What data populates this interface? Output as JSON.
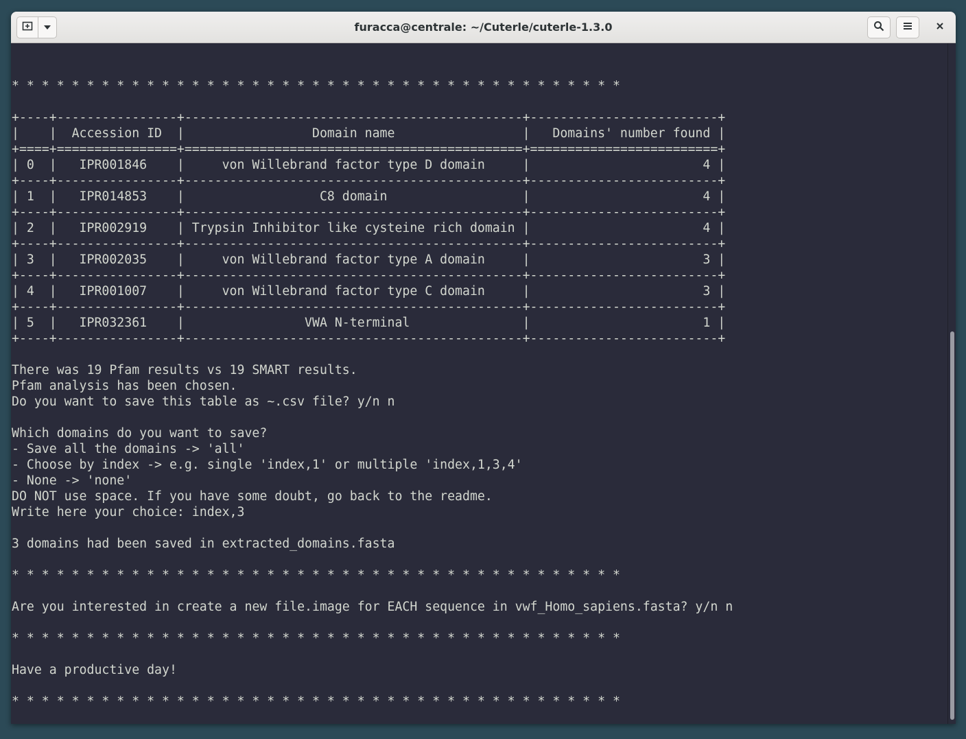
{
  "window": {
    "title": "furacca@centrale: ~/Cuterle/cuterle-1.3.0"
  },
  "icons": {
    "new_tab": "new-tab-icon",
    "dropdown": "chevron-down-icon",
    "search": "search-icon",
    "menu": "hamburger-menu-icon",
    "close": "close-icon"
  },
  "colors": {
    "terminal_bg": "#2a2b3a",
    "terminal_fg": "#d3d7cf",
    "prompt_user": "#8ae234",
    "prompt_path": "#729fcf",
    "desktop_bg": "#2c4a57"
  },
  "terminal": {
    "lines": [
      "",
      "* * * * * * * * * * * * * * * * * * * * * * * * * * * * * * * * * * * * * * * * *",
      "",
      "+----+----------------+---------------------------------------------+-------------------------+",
      "|    |  Accession ID  |                 Domain name                 |   Domains' number found |",
      "+====+================+=============================================+=========================+",
      "| 0  |   IPR001846    |     von Willebrand factor type D domain     |                       4 |",
      "+----+----------------+---------------------------------------------+-------------------------+",
      "| 1  |   IPR014853    |                  C8 domain                  |                       4 |",
      "+----+----------------+---------------------------------------------+-------------------------+",
      "| 2  |   IPR002919    | Trypsin Inhibitor like cysteine rich domain |                       4 |",
      "+----+----------------+---------------------------------------------+-------------------------+",
      "| 3  |   IPR002035    |     von Willebrand factor type A domain     |                       3 |",
      "+----+----------------+---------------------------------------------+-------------------------+",
      "| 4  |   IPR001007    |     von Willebrand factor type C domain     |                       3 |",
      "+----+----------------+---------------------------------------------+-------------------------+",
      "| 5  |   IPR032361    |                VWA N-terminal               |                       1 |",
      "+----+----------------+---------------------------------------------+-------------------------+",
      "",
      "There was 19 Pfam results vs 19 SMART results.",
      "Pfam analysis has been chosen.",
      "Do you want to save this table as ~.csv file? y/n n",
      "",
      "Which domains do you want to save?",
      "- Save all the domains -> 'all'",
      "- Choose by index -> e.g. single 'index,1' or multiple 'index,1,3,4'",
      "- None -> 'none'",
      "DO NOT use space. If you have some doubt, go back to the readme.",
      "Write here your choice: index,3",
      "",
      "3 domains had been saved in extracted_domains.fasta",
      "",
      "* * * * * * * * * * * * * * * * * * * * * * * * * * * * * * * * * * * * * * * * *",
      "",
      "Are you interested in create a new file.image for EACH sequence in vwf_Homo_sapiens.fasta? y/n n",
      "",
      "* * * * * * * * * * * * * * * * * * * * * * * * * * * * * * * * * * * * * * * * *",
      "",
      "Have a productive day!",
      "",
      "* * * * * * * * * * * * * * * * * * * * * * * * * * * * * * * * * * * * * * * * *",
      ""
    ],
    "prompt": {
      "user_host": "furacca@centrale",
      "separator": ":",
      "path": "~/Cuterle/cuterle-1.3.0",
      "symbol": "$ "
    }
  }
}
